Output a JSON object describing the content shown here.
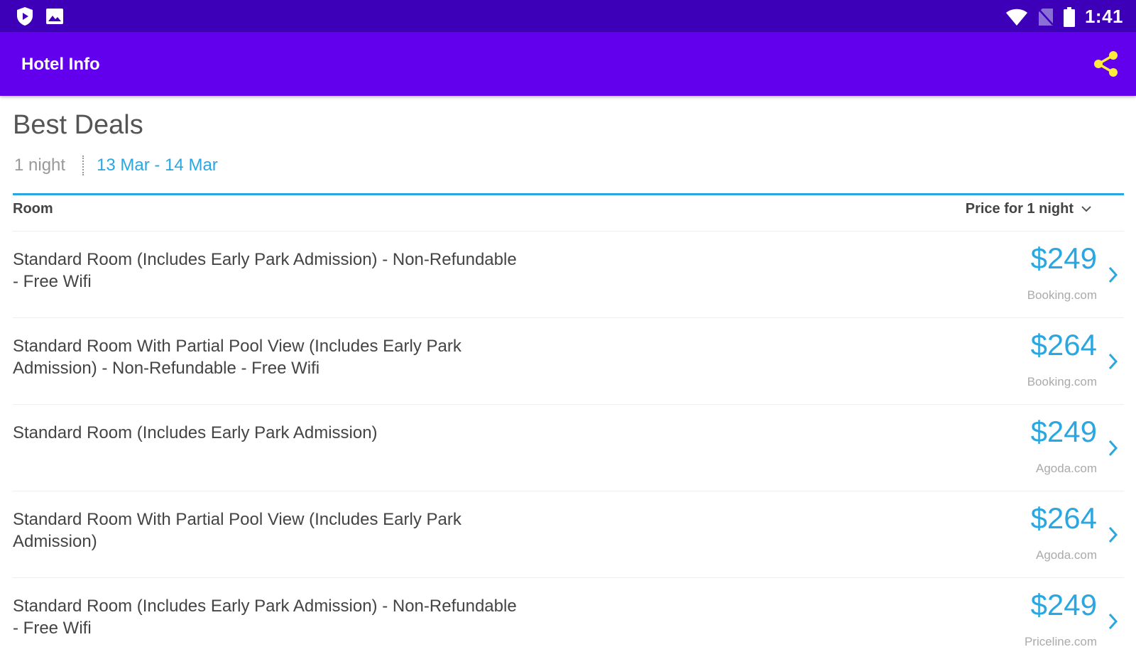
{
  "status_bar": {
    "time": "1:41",
    "left_icons": [
      "shield-play-icon",
      "image-icon"
    ],
    "right_icons": [
      "wifi-icon",
      "no-sim-icon",
      "battery-icon"
    ]
  },
  "app_bar": {
    "title": "Hotel Info",
    "share_icon": "share-icon",
    "background": "#6200ee",
    "accent": "#ffeb3b"
  },
  "deals": {
    "title": "Best Deals",
    "nights": "1 night",
    "dates": "13 Mar - 14 Mar",
    "header": {
      "room": "Room",
      "price": "Price for 1 night"
    },
    "rows": [
      {
        "room": "Standard Room (Includes Early Park Admission) - Non-Refundable - Free Wifi",
        "price": "$249",
        "provider": "Booking.com"
      },
      {
        "room": "Standard Room With Partial Pool View (Includes Early Park Admission) - Non-Refundable - Free Wifi",
        "price": "$264",
        "provider": "Booking.com"
      },
      {
        "room": "Standard Room (Includes Early Park Admission)",
        "price": "$249",
        "provider": "Agoda.com"
      },
      {
        "room": "Standard Room With Partial Pool View (Includes Early Park Admission)",
        "price": "$264",
        "provider": "Agoda.com"
      },
      {
        "room": "Standard Room (Includes Early Park Admission) - Non-Refundable - Free Wifi",
        "price": "$249",
        "provider": "Priceline.com"
      }
    ]
  }
}
